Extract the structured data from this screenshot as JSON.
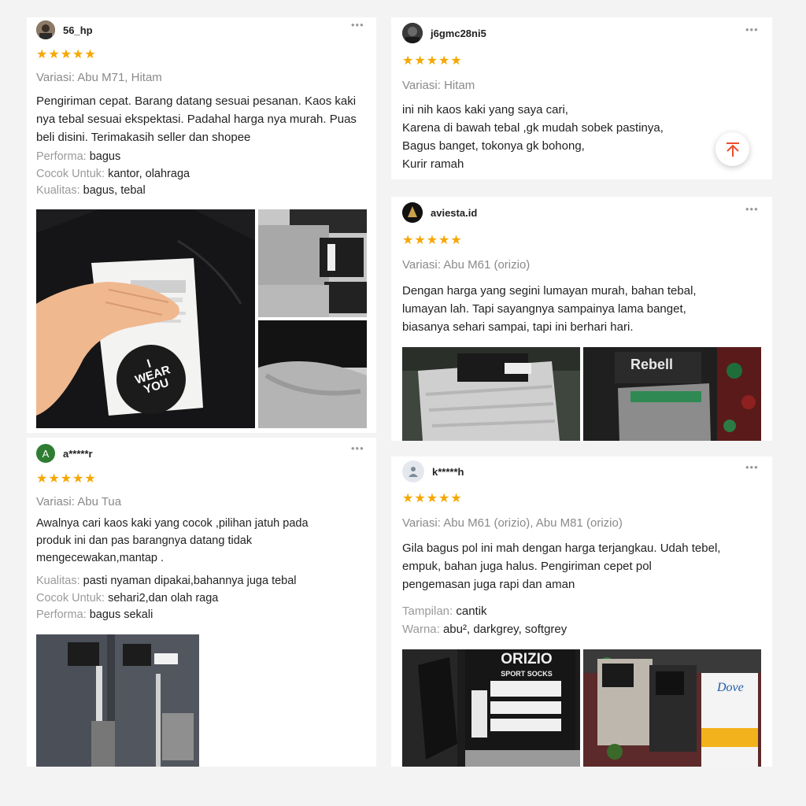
{
  "reviews": [
    {
      "username": "56_hp",
      "variation": "Variasi: Abu M71, Hitam",
      "text_lines": [
        "Pengiriman cepat. Barang datang sesuai pesanan. Kaos kaki",
        "nya tebal sesuai ekspektasi. Padahal harga nya murah.  Puas",
        "beli disini. Terimakasih seller dan shopee"
      ],
      "attributes": [
        {
          "label": "Performa:",
          "value": "bagus"
        },
        {
          "label": "Cocok Untuk:",
          "value": "kantor, olahraga"
        },
        {
          "label": "Kualitas:",
          "value": "bagus, tebal"
        }
      ],
      "photo_text": {
        "word1": "I",
        "word2": "WEAR",
        "word3": "YOU"
      }
    },
    {
      "username": "j6gmc28ni5",
      "variation": "Variasi: Hitam",
      "text_lines": [
        "ini nih kaos kaki yang saya cari,",
        "Karena di bawah tebal ,gk mudah sobek pastinya,",
        "Bagus banget, tokonya gk bohong,",
        "Kurir ramah"
      ]
    },
    {
      "username": "aviesta.id",
      "variation": "Variasi: Abu M61 (orizio)",
      "text_lines": [
        "Dengan harga yang segini lumayan murah, bahan tebal,",
        "lumayan lah. Tapi sayangnya sampainya lama banget,",
        "biasanya sehari sampai, tapi ini berhari hari."
      ],
      "photo_text": {
        "brand": "Rebell"
      }
    },
    {
      "username": "a*****r",
      "avatar_letter": "A",
      "variation": "Variasi: Abu Tua",
      "text_lines": [
        "Awalnya cari kaos kaki yang cocok ,pilihan jatuh pada",
        "produk ini dan pas barangnya datang tidak",
        "mengecewakan,mantap ."
      ],
      "attributes": [
        {
          "label": "Kualitas:",
          "value": "pasti nyaman dipakai,bahannya juga tebal"
        },
        {
          "label": "Cocok Untuk:",
          "value": "sehari2,dan olah raga"
        },
        {
          "label": "Performa:",
          "value": "bagus sekali"
        }
      ]
    },
    {
      "username": "k*****h",
      "variation": "Variasi: Abu M61 (orizio), Abu M81 (orizio)",
      "text_lines": [
        "Gila bagus pol ini mah dengan harga terjangkau. Udah tebel,",
        "empuk, bahan juga halus. Pengiriman cepet pol",
        "pengemasan juga rapi dan aman"
      ],
      "attributes": [
        {
          "label": "Tampilan:",
          "value": "cantik"
        },
        {
          "label": "Warna:",
          "value": "abu², darkgrey, softgrey"
        }
      ],
      "photo_text": {
        "brand": "ORIZIO",
        "sub": "SPORT SOCKS",
        "brand2": "Dove"
      }
    }
  ],
  "more_label": "•••",
  "star_glyph": "★",
  "rating_stars": 5,
  "colors": {
    "star": "#f6a700",
    "accent": "#ee4d2d"
  },
  "icons": {
    "more": "more-dots-icon",
    "scroll_top": "arrow-up-icon",
    "default_avatar": "person-icon"
  }
}
